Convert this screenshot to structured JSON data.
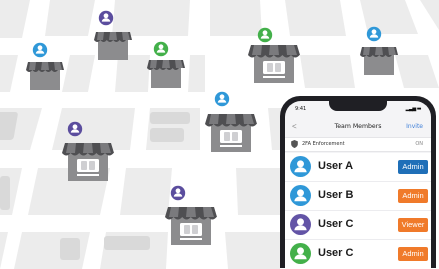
{
  "phone": {
    "status_time": "9:41",
    "screen_title": "Team Members",
    "back_glyph": "<",
    "invite_label": "Invite",
    "security_row": {
      "label": "2FA Enforcement",
      "value": "ON",
      "icon": "shield-icon"
    },
    "members": [
      {
        "name": "User A",
        "role": "Admin",
        "avatar_color": "#2f98d8",
        "role_color": "#1f6fb8"
      },
      {
        "name": "User B",
        "role": "Admin",
        "avatar_color": "#2f98d8",
        "role_color": "#f07a2a"
      },
      {
        "name": "User C",
        "role": "Viewer",
        "avatar_color": "#6354a6",
        "role_color": "#f07a2a"
      },
      {
        "name": "User C",
        "role": "Admin",
        "avatar_color": "#43b04a",
        "role_color": "#f07a2a"
      }
    ]
  },
  "map": {
    "store_icon": "store-icon",
    "pin_colors": {
      "blue": "#2f98d8",
      "purple": "#5b4d9e",
      "green": "#43b04a"
    }
  }
}
